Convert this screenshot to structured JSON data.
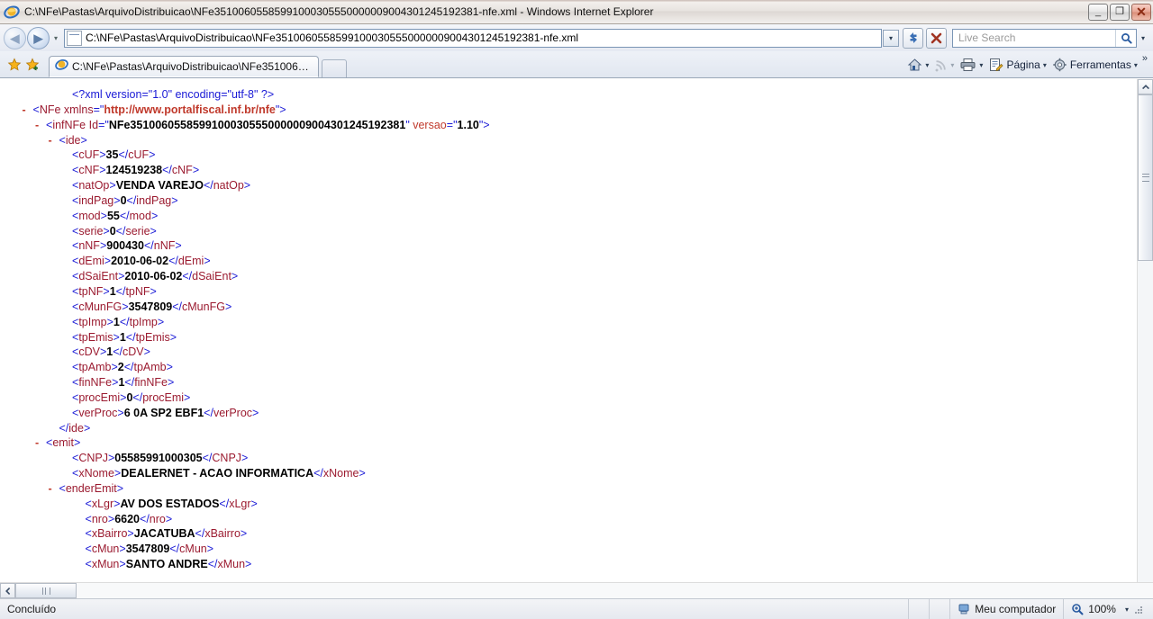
{
  "window": {
    "title": "C:\\NFe\\Pastas\\ArquivoDistribuicao\\NFe35100605585991000305550000009004301245192381-nfe.xml - Windows Internet Explorer",
    "minimize_label": "_",
    "maximize_label": "❐",
    "close_label": "✕"
  },
  "navigation": {
    "back_label": "◀",
    "forward_label": "▶",
    "history_caret": "▾",
    "address_value": "C:\\NFe\\Pastas\\ArquivoDistribuicao\\NFe35100605585991000305550000009004301245192381-nfe.xml",
    "address_dropdown_caret": "▾",
    "refresh_label": "↻",
    "stop_label": "✕",
    "search_placeholder": "Live Search",
    "search_go_label": "⚲",
    "search_caret": "▾"
  },
  "favorites": {
    "add_label": "★",
    "bar_label": "★"
  },
  "tab": {
    "title": "C:\\NFe\\Pastas\\ArquivoDistribuicao\\NFe35100605585...",
    "new_tab_label": ""
  },
  "command_bar": {
    "home_label": "",
    "home_caret": "▾",
    "feeds_label": "",
    "feeds_caret": "▾",
    "print_label": "",
    "print_caret": "▾",
    "page_label": "Página",
    "page_caret": "▾",
    "tools_label": "Ferramentas",
    "tools_caret": "▾",
    "overflow_label": "»"
  },
  "status_bar": {
    "status_text": "Concluído",
    "zone_text": "Meu computador",
    "zoom_text": "100%",
    "zoom_caret": "▾",
    "zoom_icon": "magnifier-plus-icon"
  },
  "scrollbars": {
    "v_up": "▲",
    "v_down": "▼",
    "h_left": "◀",
    "h_right": "▶"
  },
  "colors": {
    "bracket": "#1a1ad6",
    "tag": "#9b1b30",
    "attribute": "#c0392b",
    "value": "#000000",
    "marker": "#c0392b"
  },
  "xml_document": {
    "declaration": {
      "indent": 4,
      "text": "<?xml version=\"1.0\" encoding=\"utf-8\" ?>"
    },
    "lines": [
      {
        "indent": 1,
        "marker": "-",
        "type": "open_ns",
        "tag": "NFe",
        "attr": "xmlns",
        "attr_value": "http://www.portalfiscal.inf.br/nfe"
      },
      {
        "indent": 2,
        "marker": "-",
        "type": "open_attrs2",
        "tag": "infNFe",
        "attr1": "Id",
        "attr1_value": "NFe35100605585991000305550000009004301245192381",
        "attr2": "versao",
        "attr2_value": "1.10"
      },
      {
        "indent": 3,
        "marker": "-",
        "type": "open",
        "tag": "ide"
      },
      {
        "indent": 4,
        "marker": "",
        "type": "leaf",
        "tag": "cUF",
        "value": "35"
      },
      {
        "indent": 4,
        "marker": "",
        "type": "leaf",
        "tag": "cNF",
        "value": "124519238"
      },
      {
        "indent": 4,
        "marker": "",
        "type": "leaf",
        "tag": "natOp",
        "value": "VENDA VAREJO"
      },
      {
        "indent": 4,
        "marker": "",
        "type": "leaf",
        "tag": "indPag",
        "value": "0"
      },
      {
        "indent": 4,
        "marker": "",
        "type": "leaf",
        "tag": "mod",
        "value": "55"
      },
      {
        "indent": 4,
        "marker": "",
        "type": "leaf",
        "tag": "serie",
        "value": "0"
      },
      {
        "indent": 4,
        "marker": "",
        "type": "leaf",
        "tag": "nNF",
        "value": "900430"
      },
      {
        "indent": 4,
        "marker": "",
        "type": "leaf",
        "tag": "dEmi",
        "value": "2010-06-02"
      },
      {
        "indent": 4,
        "marker": "",
        "type": "leaf",
        "tag": "dSaiEnt",
        "value": "2010-06-02"
      },
      {
        "indent": 4,
        "marker": "",
        "type": "leaf",
        "tag": "tpNF",
        "value": "1"
      },
      {
        "indent": 4,
        "marker": "",
        "type": "leaf",
        "tag": "cMunFG",
        "value": "3547809"
      },
      {
        "indent": 4,
        "marker": "",
        "type": "leaf",
        "tag": "tpImp",
        "value": "1"
      },
      {
        "indent": 4,
        "marker": "",
        "type": "leaf",
        "tag": "tpEmis",
        "value": "1"
      },
      {
        "indent": 4,
        "marker": "",
        "type": "leaf",
        "tag": "cDV",
        "value": "1"
      },
      {
        "indent": 4,
        "marker": "",
        "type": "leaf",
        "tag": "tpAmb",
        "value": "2"
      },
      {
        "indent": 4,
        "marker": "",
        "type": "leaf",
        "tag": "finNFe",
        "value": "1"
      },
      {
        "indent": 4,
        "marker": "",
        "type": "leaf",
        "tag": "procEmi",
        "value": "0"
      },
      {
        "indent": 4,
        "marker": "",
        "type": "leaf",
        "tag": "verProc",
        "value": "6 0A SP2 EBF1"
      },
      {
        "indent": 3,
        "marker": "",
        "type": "close",
        "tag": "ide"
      },
      {
        "indent": 2,
        "marker": "-",
        "type": "open",
        "tag": "emit"
      },
      {
        "indent": 4,
        "marker": "",
        "type": "leaf",
        "tag": "CNPJ",
        "value": "05585991000305"
      },
      {
        "indent": 4,
        "marker": "",
        "type": "leaf",
        "tag": "xNome",
        "value": "DEALERNET - ACAO INFORMATICA"
      },
      {
        "indent": 3,
        "marker": "-",
        "type": "open",
        "tag": "enderEmit"
      },
      {
        "indent": 5,
        "marker": "",
        "type": "leaf",
        "tag": "xLgr",
        "value": "AV DOS ESTADOS"
      },
      {
        "indent": 5,
        "marker": "",
        "type": "leaf",
        "tag": "nro",
        "value": "6620"
      },
      {
        "indent": 5,
        "marker": "",
        "type": "leaf",
        "tag": "xBairro",
        "value": "JACATUBA"
      },
      {
        "indent": 5,
        "marker": "",
        "type": "leaf",
        "tag": "cMun",
        "value": "3547809"
      },
      {
        "indent": 5,
        "marker": "",
        "type": "leaf",
        "tag": "xMun",
        "value": "SANTO ANDRE"
      }
    ]
  }
}
